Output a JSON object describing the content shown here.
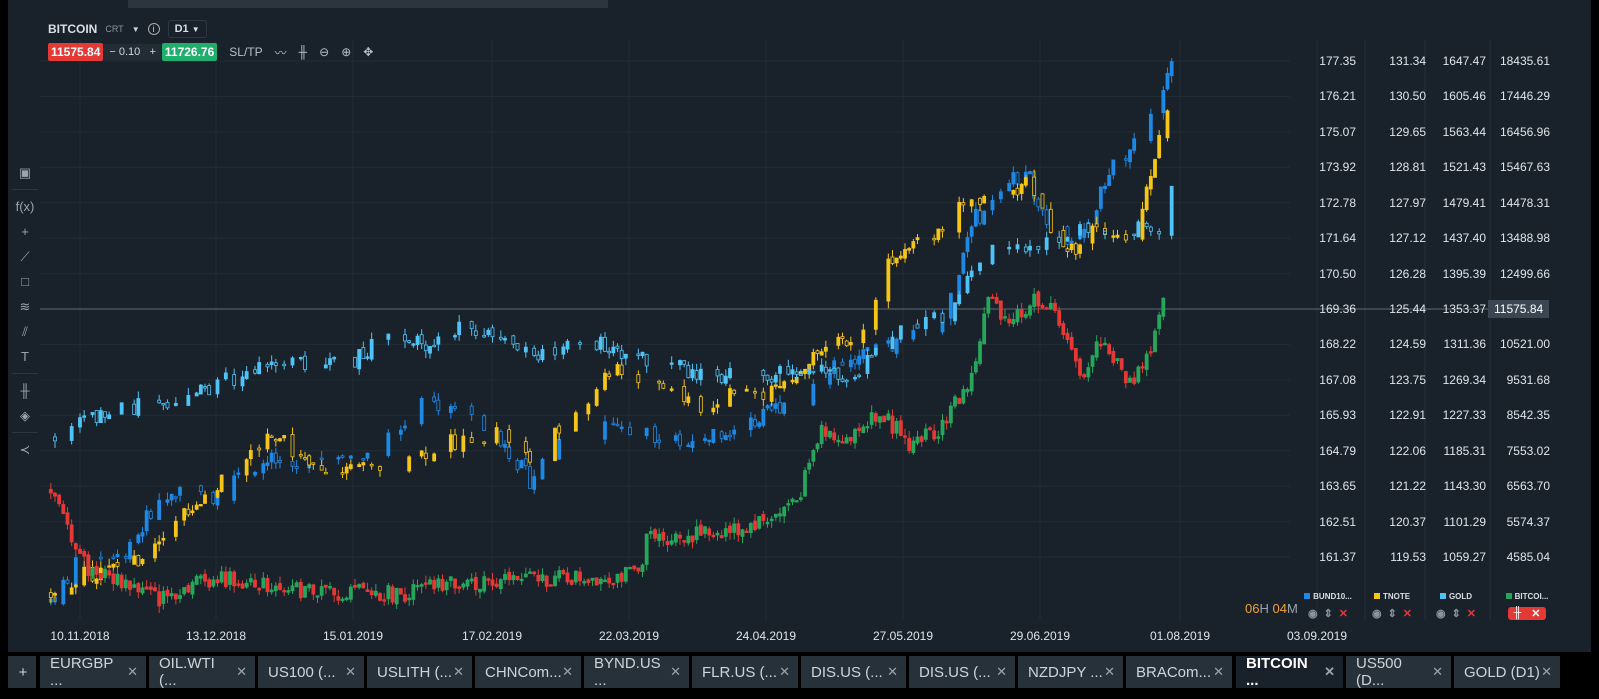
{
  "header": {
    "symbol": "BITCOIN",
    "type": "CRT",
    "timeframe": "D1",
    "sell_price": "11575.84",
    "lot": "0.10",
    "buy_price": "11726.76",
    "sltp": "SL/TP"
  },
  "price_axes": [
    [
      "177.35",
      "176.21",
      "175.07",
      "173.92",
      "172.78",
      "171.64",
      "170.50",
      "169.36",
      "168.22",
      "167.08",
      "165.93",
      "164.79",
      "163.65",
      "162.51",
      "161.37"
    ],
    [
      "131.34",
      "130.50",
      "129.65",
      "128.81",
      "127.97",
      "127.12",
      "126.28",
      "125.44",
      "124.59",
      "123.75",
      "122.91",
      "122.06",
      "121.22",
      "120.37",
      "119.53"
    ],
    [
      "1647.47",
      "1605.46",
      "1563.44",
      "1521.43",
      "1479.41",
      "1437.40",
      "1395.39",
      "1353.37",
      "1311.36",
      "1269.34",
      "1227.33",
      "1185.31",
      "1143.30",
      "1101.29",
      "1059.27"
    ],
    [
      "18435.61",
      "17446.29",
      "16456.96",
      "15467.63",
      "14478.31",
      "13488.98",
      "12499.66",
      "11575.84",
      "10521.00",
      "9531.68",
      "8542.35",
      "7553.02",
      "6563.70",
      "5574.37",
      "4585.04"
    ]
  ],
  "current_price": "11575.84",
  "dates": [
    "10.11.2018",
    "13.12.2018",
    "15.01.2019",
    "17.02.2019",
    "22.03.2019",
    "24.04.2019",
    "27.05.2019",
    "29.06.2019",
    "01.08.2019",
    "03.09.2019"
  ],
  "timer": {
    "h": "06",
    "hl": "H",
    "m": "04",
    "ml": "M"
  },
  "legend": [
    {
      "name": "BUND10...",
      "color": "#1e88e5"
    },
    {
      "name": "TNOTE",
      "color": "#f5c518"
    },
    {
      "name": "GOLD",
      "color": "#4fc3f7"
    },
    {
      "name": "BITCOI...",
      "color": "#26a65b"
    }
  ],
  "tabs": [
    "EURGBP ...",
    "OIL.WTI (...",
    "US100 (...",
    "USLITH (...",
    "CHNCom...",
    "BYND.US ...",
    "FLR.US (...",
    "DIS.US (...",
    "DIS.US (...",
    "NZDJPY ...",
    "BRACom...",
    "BITCOIN ...",
    "US500 (D...",
    "GOLD (D1)"
  ],
  "active_tab": 11,
  "chart_data": {
    "type": "candlestick",
    "x_unit": "days since 10.11.2018",
    "series": [
      {
        "name": "BUND10",
        "axis": 0,
        "color": "#1e88e5",
        "days": [
          -7,
          0,
          12,
          17,
          24,
          31,
          38,
          46,
          53,
          60,
          67,
          77,
          82,
          91,
          101,
          108,
          115,
          125,
          134,
          144,
          154,
          163,
          173,
          180,
          187,
          197,
          204,
          209,
          214,
          218,
          223,
          228,
          233,
          238,
          242,
          247,
          254,
          259,
          262
        ],
        "close": [
          159.98,
          161.27,
          161.59,
          162.88,
          163.52,
          163.2,
          164.17,
          164.49,
          164.17,
          164.82,
          164.49,
          165.46,
          166.43,
          166.11,
          165.14,
          163.85,
          165.14,
          165.78,
          165.46,
          165.14,
          165.46,
          165.78,
          166.75,
          167.39,
          167.72,
          168.36,
          169.0,
          169.65,
          172.23,
          172.55,
          173.52,
          173.52,
          171.91,
          171.58,
          171.91,
          173.84,
          174.8,
          176.09,
          177.06
        ]
      },
      {
        "name": "TNOTE",
        "axis": 1,
        "color": "#f5c518",
        "days": [
          -7,
          0,
          7,
          14,
          22,
          29,
          38,
          46,
          53,
          60,
          67,
          77,
          84,
          91,
          101,
          108,
          115,
          122,
          127,
          134,
          142,
          149,
          156,
          163,
          170,
          178,
          185,
          190,
          194,
          199,
          206,
          211,
          218,
          223,
          228,
          233,
          238,
          245,
          252,
          257,
          259,
          262
        ],
        "close": [
          118.74,
          119.1,
          119.22,
          119.46,
          120.41,
          120.89,
          121.6,
          122.55,
          121.84,
          121.36,
          121.6,
          121.84,
          122.08,
          122.32,
          122.55,
          121.84,
          122.55,
          123.27,
          123.98,
          123.74,
          123.5,
          123.03,
          123.5,
          123.39,
          123.74,
          124.46,
          124.69,
          125.41,
          126.6,
          127.07,
          127.31,
          127.79,
          128.02,
          128.26,
          128.5,
          127.31,
          126.84,
          127.43,
          127.2,
          128.51,
          129.7,
          130.41
        ]
      },
      {
        "name": "GOLD",
        "axis": 2,
        "color": "#4fc3f7",
        "days": [
          -7,
          5,
          17,
          29,
          41,
          53,
          65,
          72,
          82,
          92,
          101,
          108,
          125,
          134,
          149,
          163,
          173,
          185,
          192,
          199,
          206,
          211,
          216,
          221,
          228,
          235,
          240,
          245,
          250,
          254,
          259,
          262
        ],
        "close": [
          1204,
          1228,
          1240,
          1257,
          1281,
          1290,
          1287,
          1316,
          1311,
          1334,
          1316,
          1299,
          1311,
          1299,
          1275,
          1271,
          1281,
          1275,
          1305,
          1334,
          1340,
          1364,
          1411,
          1435,
          1423,
          1435,
          1453,
          1441,
          1423,
          1447,
          1447,
          1506
        ]
      },
      {
        "name": "BITCOIN",
        "axis": 3,
        "color": "#26a65b",
        "down_color": "#e53935",
        "days": [
          -7,
          -4,
          2,
          12,
          19,
          29,
          41,
          53,
          77,
          91,
          106,
          125,
          134,
          136,
          149,
          158,
          168,
          173,
          178,
          185,
          192,
          199,
          206,
          214,
          218,
          223,
          230,
          235,
          240,
          245,
          252,
          257,
          260
        ],
        "close": [
          6458,
          5620,
          4224,
          3806,
          3386,
          3945,
          3945,
          3666,
          3527,
          3889,
          3945,
          4001,
          4085,
          5062,
          5201,
          5341,
          5760,
          6458,
          8133,
          7854,
          8691,
          7714,
          8133,
          9529,
          11762,
          11204,
          11762,
          11204,
          9529,
          10646,
          9389,
          10367,
          11623
        ]
      }
    ]
  }
}
